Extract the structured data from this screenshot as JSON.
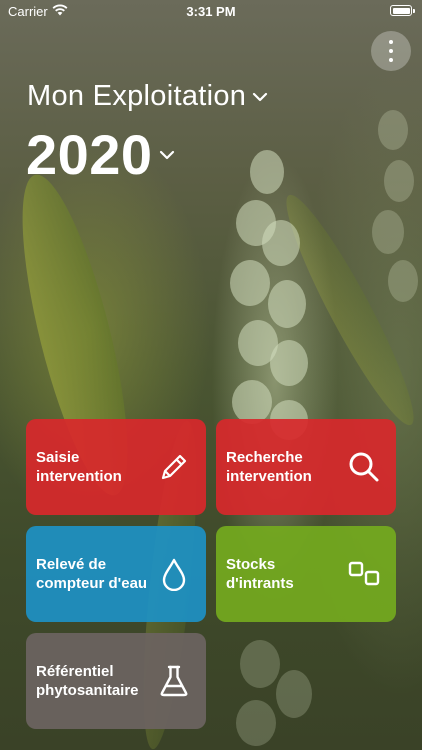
{
  "status_bar": {
    "carrier": "Carrier",
    "time": "3:31 PM"
  },
  "header": {
    "farm": "Mon Exploitation",
    "year": "2020"
  },
  "tiles": [
    {
      "label": "Saisie intervention",
      "icon": "pencil-icon",
      "color": "#d8282b"
    },
    {
      "label": "Recherche intervention",
      "icon": "search-icon",
      "color": "#d8282b"
    },
    {
      "label": "Relevé de compteur d'eau",
      "icon": "water-drop-icon",
      "color": "#1d91c4"
    },
    {
      "label": "Stocks d'intrants",
      "icon": "stock-squares-icon",
      "color": "#74aa1e"
    },
    {
      "label": "Référentiel phytosanitaire",
      "icon": "flask-icon",
      "color": "#6b6360"
    }
  ]
}
